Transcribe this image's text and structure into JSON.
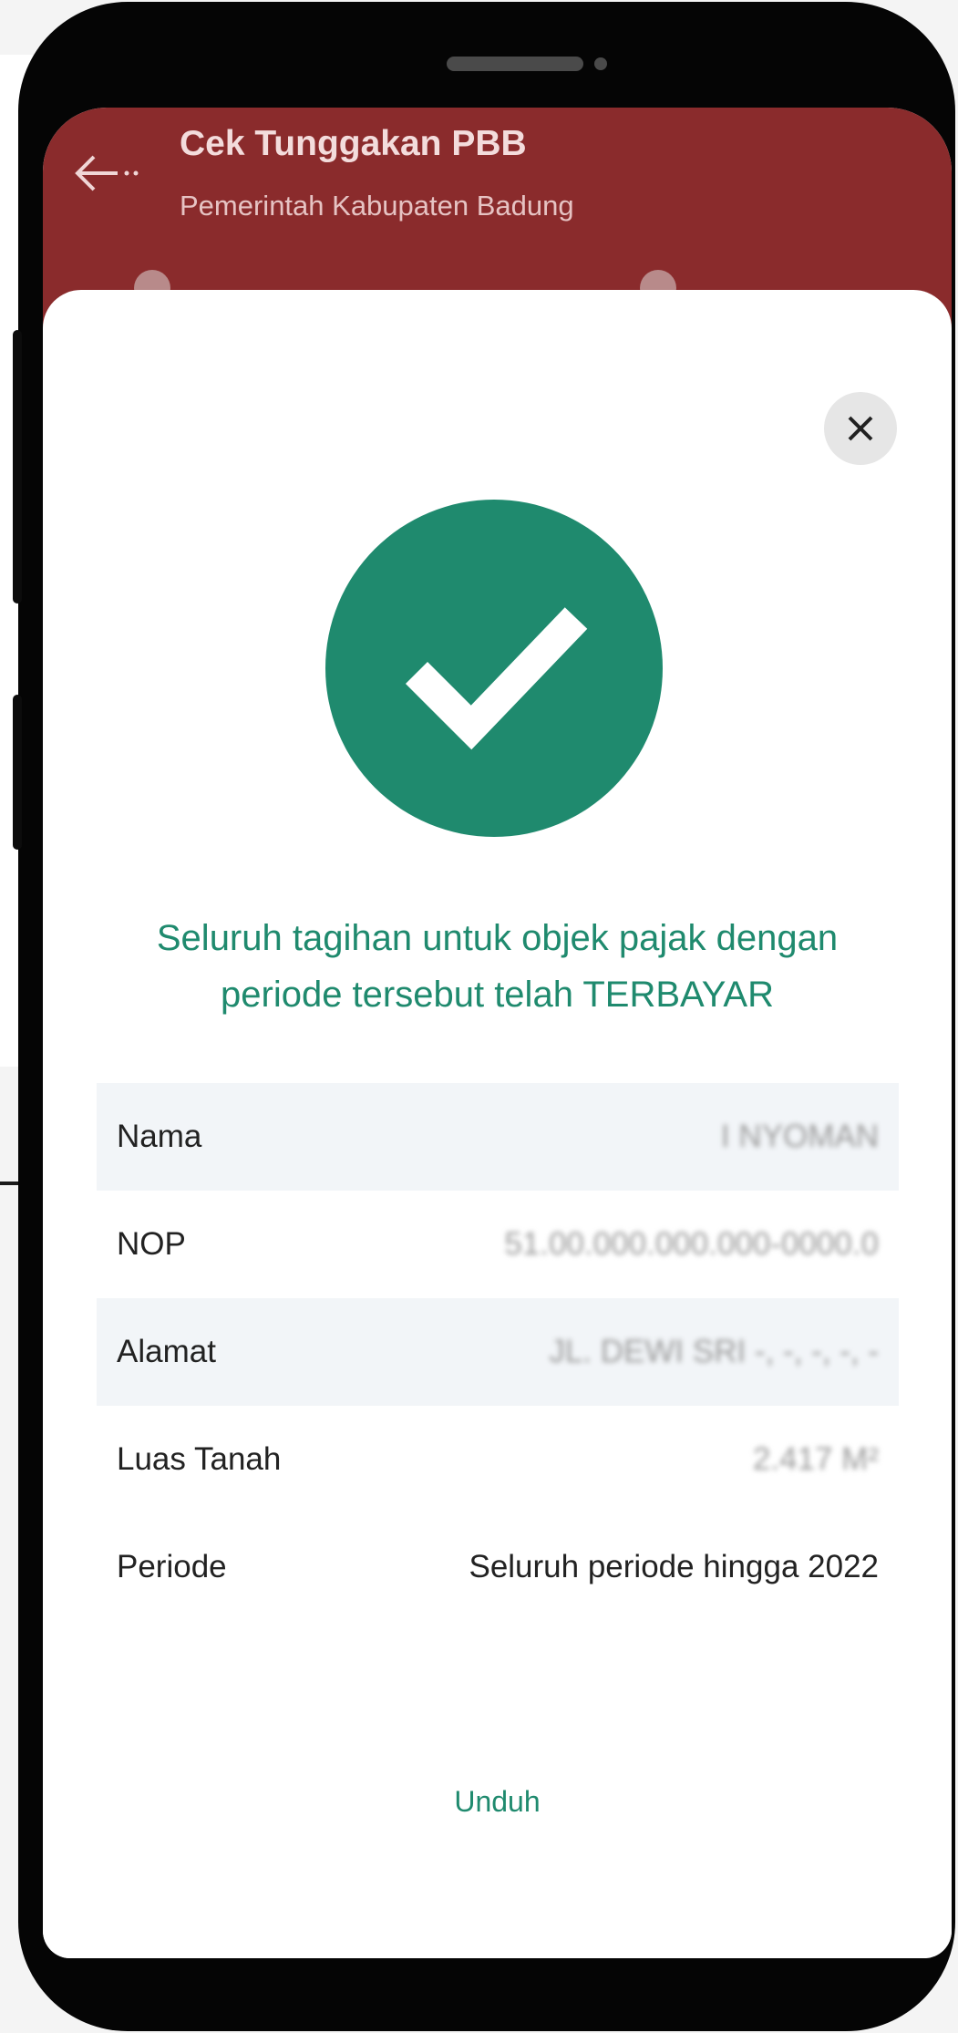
{
  "app_bar": {
    "title": "Cek Tunggakan PBB",
    "subtitle": "Pemerintah Kabupaten Badung"
  },
  "modal": {
    "message_line1": "Seluruh tagihan untuk objek pajak dengan",
    "message_line2": "periode tersebut telah TERBAYAR",
    "rows": [
      {
        "label": "Nama",
        "value": "I NYOMAN"
      },
      {
        "label": "NOP",
        "value": "51.00.000.000.000-0000.0"
      },
      {
        "label": "Alamat",
        "value": "JL. DEWI SRI -, -, -, -, -"
      },
      {
        "label": "Luas Tanah",
        "value": "2.417 M²"
      },
      {
        "label": "Periode",
        "value": "Seluruh periode hingga 2022"
      }
    ],
    "download_label": "Unduh"
  },
  "icons": {
    "back": "arrow-left-icon",
    "close": "close-icon",
    "success": "check-icon"
  },
  "colors": {
    "app_bar": "#8a2b2c",
    "success_green": "#1f8a6e"
  }
}
